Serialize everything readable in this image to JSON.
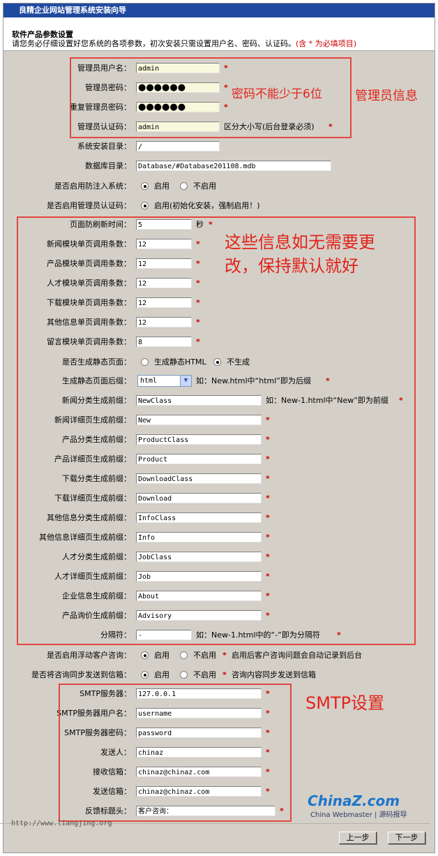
{
  "window": {
    "title": "良精企业网站管理系统安装向导"
  },
  "header": {
    "title": "软件产品参数设置",
    "description": "请您务必仔细设置好您系统的各项参数，初次安装只需设置用户名、密码、认证码。",
    "note": "(含 * 为必填项目)"
  },
  "admin": {
    "username_label": "管理员用户名：",
    "username_value": "admin",
    "password_label": "管理员密码：",
    "password_value": "●●●●●●",
    "password2_label": "重复管理员密码：",
    "password2_value": "●●●●●●",
    "authcode_label": "管理员认证码：",
    "authcode_value": "admin",
    "authcode_hint": "区分大小写(后台登录必须)"
  },
  "system": {
    "install_dir_label": "系统安装目录：",
    "install_dir_value": "/",
    "db_dir_label": "数据库目录：",
    "db_dir_value": "Database/#Database201108.mdb",
    "anti_inject_label": "是否启用防注入系统：",
    "anti_inject_on": "启用",
    "anti_inject_off": "不启用",
    "admin_code_label": "是否启用管理员认证码：",
    "admin_code_on": "启用(初始化安装，强制启用！)"
  },
  "settings": [
    {
      "label": "页面防刷新时间：",
      "value": "5",
      "suffix": "秒"
    },
    {
      "label": "新闻模块单页调用条数：",
      "value": "12"
    },
    {
      "label": "产品模块单页调用条数：",
      "value": "12"
    },
    {
      "label": "人才模块单页调用条数：",
      "value": "12"
    },
    {
      "label": "下载模块单页调用条数：",
      "value": "12"
    },
    {
      "label": "其他信息单页调用条数：",
      "value": "12"
    },
    {
      "label": "留言模块单页调用条数：",
      "value": "8"
    }
  ],
  "static": {
    "gen_label": "是否生成静态页面：",
    "gen_on": "生成静态HTML",
    "gen_off": "不生成",
    "suffix_label": "生成静态页面后缀：",
    "suffix_value": "html",
    "suffix_hint": "如：New.html中“html”即为后缀"
  },
  "prefixes": [
    {
      "label": "新闻分类生成前缀：",
      "value": "NewClass",
      "hint": "如：New-1.html中“New”即为前缀"
    },
    {
      "label": "新闻详细页生成前缀：",
      "value": "New"
    },
    {
      "label": "产品分类生成前缀：",
      "value": "ProductClass"
    },
    {
      "label": "产品详细页生成前缀：",
      "value": "Product"
    },
    {
      "label": "下载分类生成前缀：",
      "value": "DownloadClass"
    },
    {
      "label": "下载详细页生成前缀：",
      "value": "Download"
    },
    {
      "label": "其他信息分类生成前缀：",
      "value": "InfoClass"
    },
    {
      "label": "其他信息详细页生成前缀：",
      "value": "Info"
    },
    {
      "label": "人才分类生成前缀：",
      "value": "JobClass"
    },
    {
      "label": "人才详细页生成前缀：",
      "value": "Job"
    },
    {
      "label": "企业信息生成前缀：",
      "value": "About"
    },
    {
      "label": "产品询价生成前缀：",
      "value": "Advisory"
    }
  ],
  "separator": {
    "label": "分隔符：",
    "value": "-",
    "hint": "如：New-1.html中的“-”即为分隔符"
  },
  "consult": {
    "float_label": "是否启用浮动客户咨询：",
    "float_on": "启用",
    "float_off": "不启用",
    "float_hint": "启用后客户咨询问题会自动记录到后台",
    "sync_label": "是否将咨询同步发送到信箱：",
    "sync_on": "启用",
    "sync_off": "不启用",
    "sync_hint": "咨询内容同步发送到信箱"
  },
  "smtp": [
    {
      "label": "SMTP服务器：",
      "value": "127.0.0.1"
    },
    {
      "label": "SMTP服务器用户名：",
      "value": "username"
    },
    {
      "label": "SMTP服务器密码：",
      "value": "password"
    },
    {
      "label": "发送人：",
      "value": "chinaz"
    },
    {
      "label": "接收信箱：",
      "value": "chinaz@chinaz.com"
    },
    {
      "label": "发送信箱：",
      "value": "chinaz@chinaz.com"
    },
    {
      "label": "反馈标题头：",
      "value": "客户咨询："
    }
  ],
  "required_mark": "*",
  "annotations": {
    "password_note": "密码不能少于6位",
    "admin_info": "管理员信息",
    "defaults_line1": "这些信息如无需要更",
    "defaults_line2": "改，保持默认就好",
    "smtp_settings": "SMTP设置"
  },
  "footer": {
    "url": "http://www.liangjing.org",
    "prev_button": "上一步",
    "next_button": "下一步"
  },
  "watermark": {
    "brand": "ChinaZ.com",
    "sub": "China Webmaster | 源码报导"
  },
  "colors": {
    "titlebar": "#1f4aa0",
    "annotation_red": "#e2231a",
    "required_red": "#d00000",
    "panel": "#d4d0c8"
  }
}
